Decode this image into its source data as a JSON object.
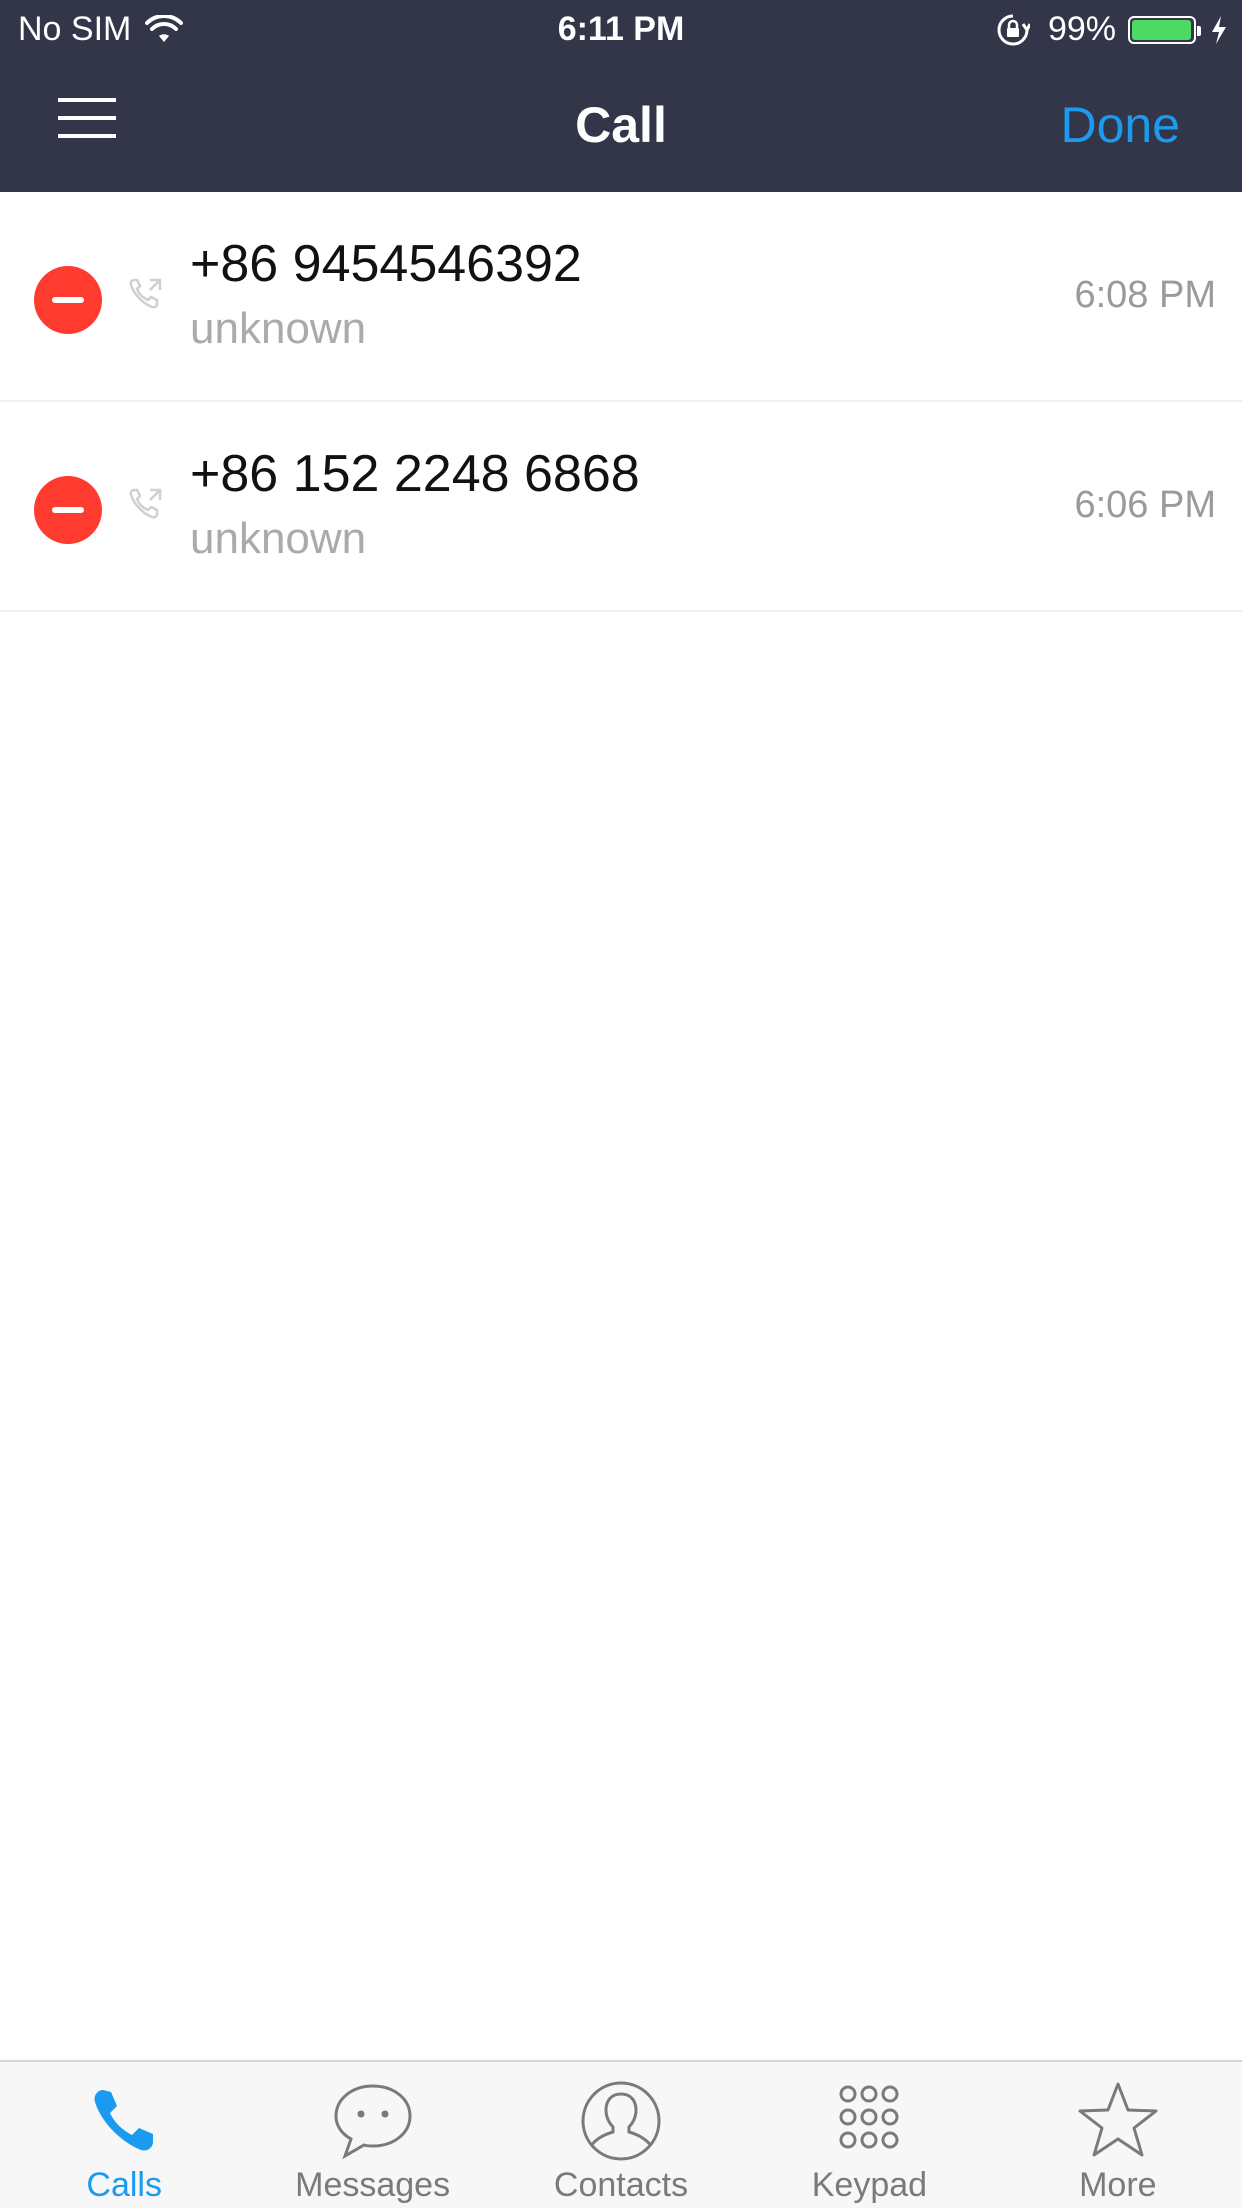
{
  "status_bar": {
    "carrier": "No SIM",
    "time": "6:11 PM",
    "battery_pct": "99%",
    "battery_level": 0.99,
    "icons": [
      "wifi-icon",
      "orientation-lock-icon",
      "battery-icon",
      "charging-bolt-icon"
    ]
  },
  "nav": {
    "menu_icon": "hamburger-menu-icon",
    "title": "Call",
    "done_label": "Done"
  },
  "calls": [
    {
      "number": "+86 9454546392",
      "label": "unknown",
      "time": "6:08 PM"
    },
    {
      "number": "+86 152 2248 6868",
      "label": "unknown",
      "time": "6:06 PM"
    }
  ],
  "tabs": [
    {
      "label": "Calls",
      "icon": "phone-icon",
      "active": true
    },
    {
      "label": "Messages",
      "icon": "chat-bubble-icon",
      "active": false
    },
    {
      "label": "Contacts",
      "icon": "person-icon",
      "active": false
    },
    {
      "label": "Keypad",
      "icon": "keypad-icon",
      "active": false
    },
    {
      "label": "More",
      "icon": "star-icon",
      "active": false
    }
  ],
  "colors": {
    "header_bg": "#333648",
    "accent": "#1a9bf0",
    "delete_red": "#ff3b30",
    "battery_green": "#4cd964",
    "tab_inactive": "#7a7a7a"
  }
}
